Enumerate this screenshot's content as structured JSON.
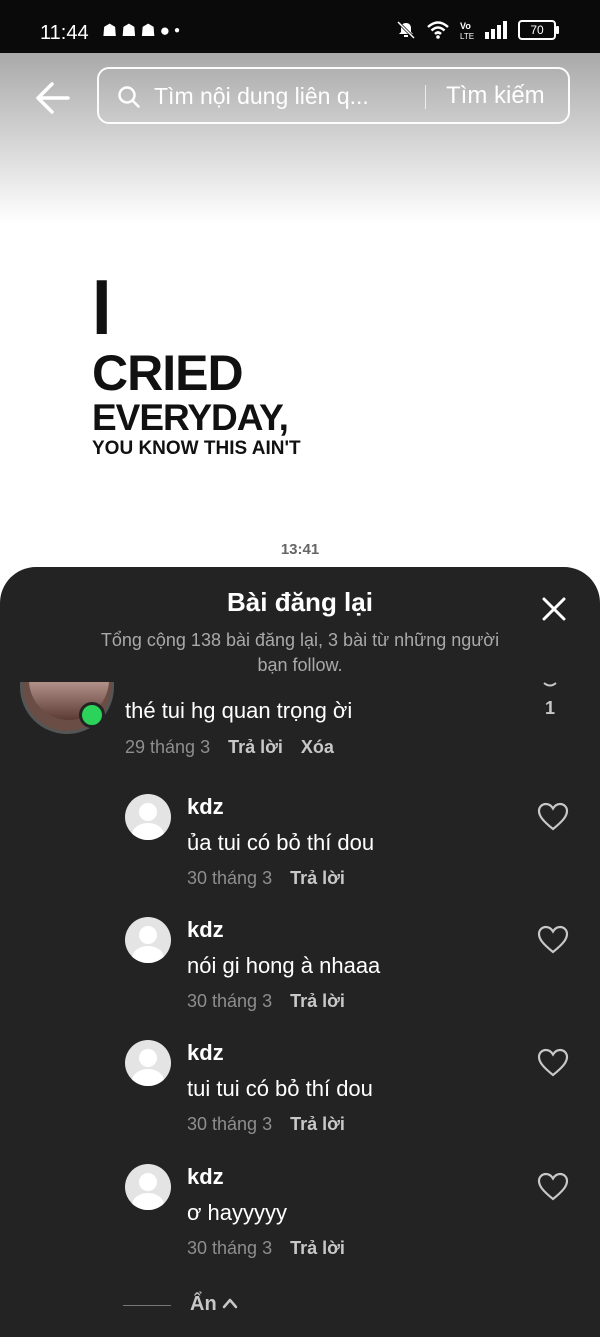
{
  "status_bar": {
    "time": "11:44",
    "left_icons": "snapchat-icon snapchat-icon snapchat-icon messenger-icon dot",
    "battery": "70"
  },
  "search": {
    "placeholder": "Tìm nội dung liên q...",
    "submit_label": "Tìm kiếm"
  },
  "post": {
    "art_lines": [
      "I",
      "CRIED",
      "EVERYDAY,",
      "YOU KNOW THIS AIN'T"
    ],
    "time": "13:41"
  },
  "sheet": {
    "title": "Bài đăng lại",
    "subtitle": "Tổng cộng 138 bài đăng lại, 3 bài từ những người bạn follow."
  },
  "top_comment": {
    "text": "thé tui hg quan trọng ời",
    "date": "29 tháng 3",
    "reply_label": "Trả lời",
    "delete_label": "Xóa",
    "like_count": "1"
  },
  "replies": [
    {
      "user": "kdz",
      "text": "ủa tui có bỏ thí dou",
      "date": "30 tháng 3",
      "reply_label": "Trả lời"
    },
    {
      "user": "kdz",
      "text": "nói gi hong à nhaaa",
      "date": "30 tháng 3",
      "reply_label": "Trả lời"
    },
    {
      "user": "kdz",
      "text": "tui tui có bỏ thí dou",
      "date": "30 tháng 3",
      "reply_label": "Trả lời"
    },
    {
      "user": "kdz",
      "text": "ơ hayyyyy",
      "date": "30 tháng 3",
      "reply_label": "Trả lời"
    }
  ],
  "hide_label": "Ẩn",
  "colors": {
    "sheet_bg": "#232323",
    "online": "#2bd35a",
    "meta_text": "#8e8e8e"
  }
}
